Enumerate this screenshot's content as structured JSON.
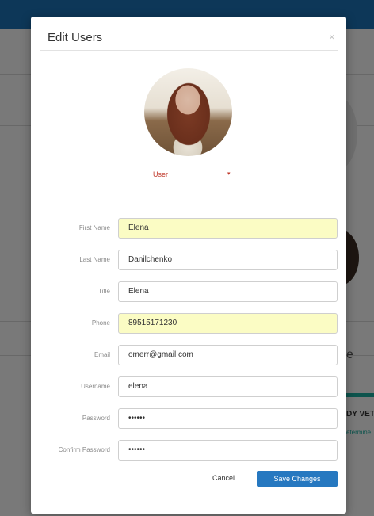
{
  "modal": {
    "title": "Edit Users",
    "close_glyph": "×"
  },
  "role_select": {
    "selected": "User",
    "caret_glyph": "▾"
  },
  "fields": [
    {
      "label": "First Name",
      "value": "Elena",
      "autofilled": true
    },
    {
      "label": "Last Name",
      "value": "Danilchenko",
      "autofilled": false
    },
    {
      "label": "Title",
      "value": "Elena",
      "autofilled": false
    },
    {
      "label": "Phone",
      "value": "89515171230",
      "autofilled": true
    },
    {
      "label": "Email",
      "value": "omerr@gmail.com",
      "autofilled": false
    },
    {
      "label": "Username",
      "value": "elena",
      "autofilled": false
    },
    {
      "label": "Password",
      "value": "••••••",
      "autofilled": false
    },
    {
      "label": "Confirm Password",
      "value": "••••••",
      "autofilled": false
    }
  ],
  "actions": {
    "cancel_label": "Cancel",
    "save_label": "Save Changes"
  },
  "background": {
    "partial_letter": "e",
    "partial_name": "DY VETT",
    "partial_sub": "etermine"
  },
  "colors": {
    "primary": "#2678c0",
    "autofill": "#fbfcc4",
    "role_text": "#c0392b",
    "topbar": "#1b6fb0",
    "accent_teal": "#1aa89a"
  }
}
